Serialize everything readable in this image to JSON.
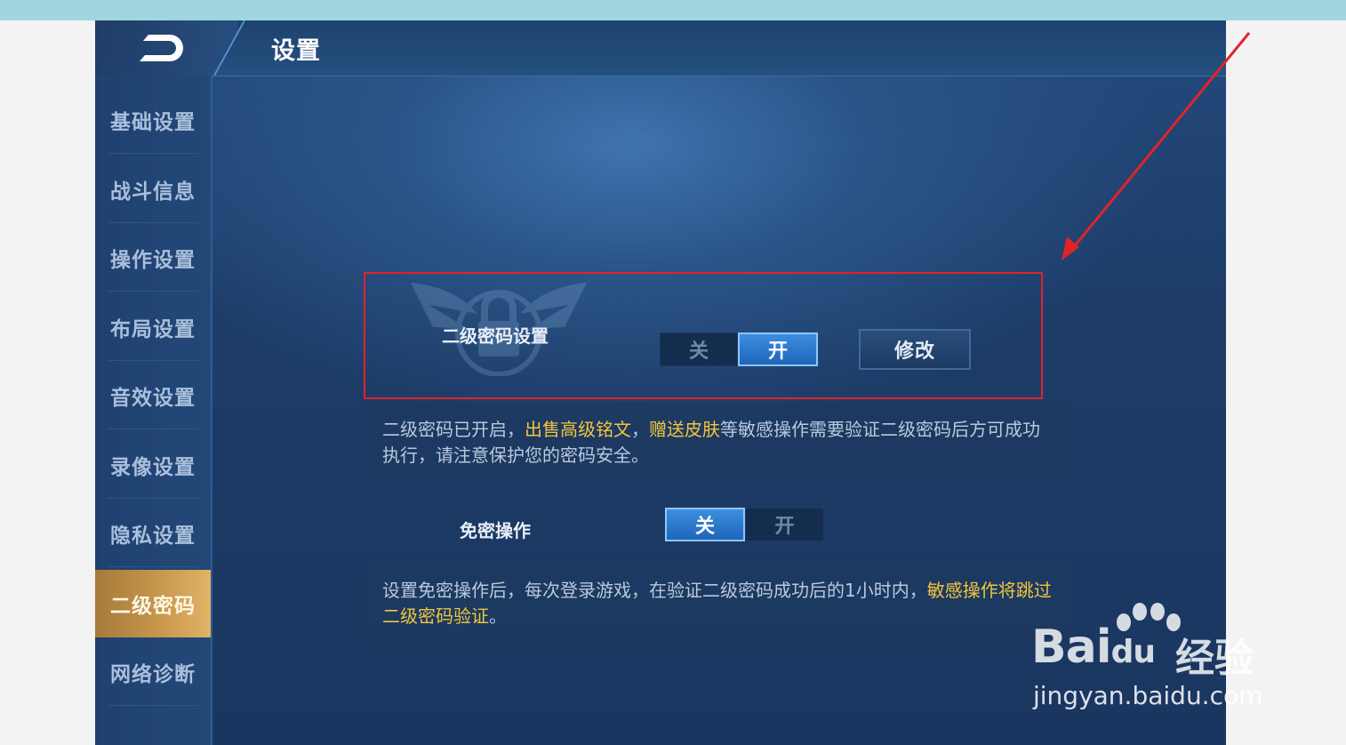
{
  "header": {
    "title": "设置"
  },
  "sidebar": {
    "items": [
      {
        "label": "基础设置",
        "active": false
      },
      {
        "label": "战斗信息",
        "active": false
      },
      {
        "label": "操作设置",
        "active": false
      },
      {
        "label": "布局设置",
        "active": false
      },
      {
        "label": "音效设置",
        "active": false
      },
      {
        "label": "录像设置",
        "active": false
      },
      {
        "label": "隐私设置",
        "active": false
      },
      {
        "label": "二级密码",
        "active": true
      },
      {
        "label": "网络诊断",
        "active": false
      }
    ]
  },
  "secondary_password": {
    "label": "二级密码设置",
    "off_label": "关",
    "on_label": "开",
    "state": "开",
    "edit_label": "修改"
  },
  "info1": {
    "part1": "二级密码已开启，",
    "highlight1": "出售高级铭文",
    "sep": "，",
    "highlight2": "赠送皮肤",
    "part2": "等敏感操作需要验证二级密码后方可成功执行，请注意保护您的密码安全。"
  },
  "password_free": {
    "label": "免密操作",
    "off_label": "关",
    "on_label": "开",
    "state": "关"
  },
  "info2": {
    "part1": "设置免密操作后，每次登录游戏，在验证二级密码成功后的1小时内，",
    "highlight": "敏感操作将跳过二级密码验证",
    "part2": "。"
  },
  "watermark": {
    "brand": "Bai",
    "brand2": "du",
    "cn": "经验",
    "url": "jingyan.baidu.com"
  },
  "colors": {
    "accent": "#f2c53d",
    "toggle_on": "#2a77cc",
    "annotation": "#e0232b"
  }
}
